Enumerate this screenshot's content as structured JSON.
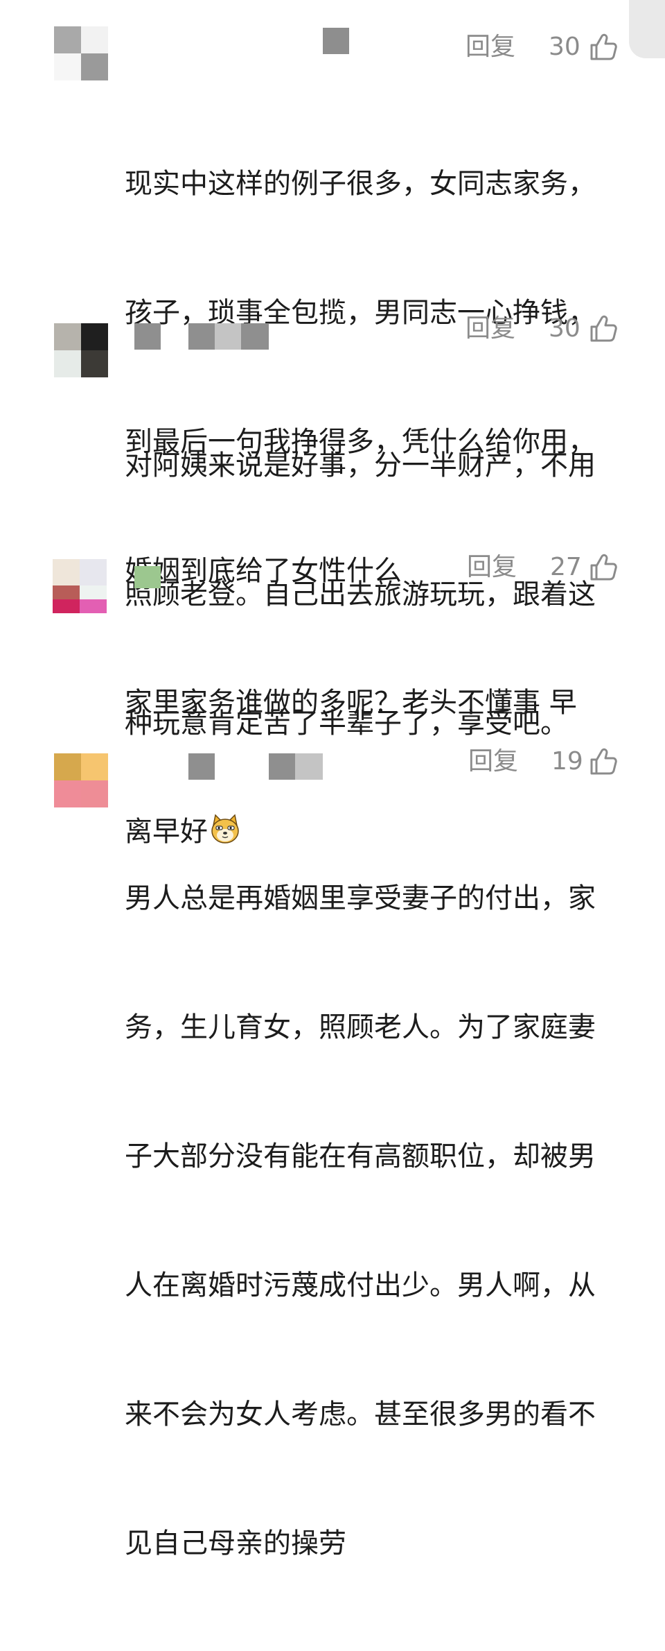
{
  "actions": {
    "reply_label": "回复"
  },
  "comments": [
    {
      "likes": "30",
      "text_lines": [
        "现实中这样的例子很多，女同志家务，",
        "孩子，琐事全包揽，男同志一心挣钱，",
        "到最后一句我挣得多，凭什么给你用，",
        "婚姻到底给了女性什么"
      ]
    },
    {
      "likes": "30",
      "text_lines": [
        "对阿姨来说是好事，分一半财产，不用",
        "照顾老登。自己出去旅游玩玩，跟着这",
        "种玩意肯定苦了半辈子了，享受吧。"
      ]
    },
    {
      "likes": "27",
      "text_lines": [
        "家里家务谁做的多呢？老头不懂事 早",
        "离早好"
      ],
      "emoji": "doge-emoji"
    },
    {
      "likes": "19",
      "text_lines": [
        "男人总是再婚姻里享受妻子的付出，家",
        "务，生儿育女，照顾老人。为了家庭妻",
        "子大部分没有能在有高额职位，却被男",
        "人在离婚时污蔑成付出少。男人啊，从",
        "来不会为女人考虑。甚至很多男的看不",
        "见自己母亲的操劳"
      ]
    }
  ],
  "icons": {
    "like": "thumbs-up-icon",
    "avatar": "pixelated-avatar",
    "username": "pixelated-username"
  }
}
